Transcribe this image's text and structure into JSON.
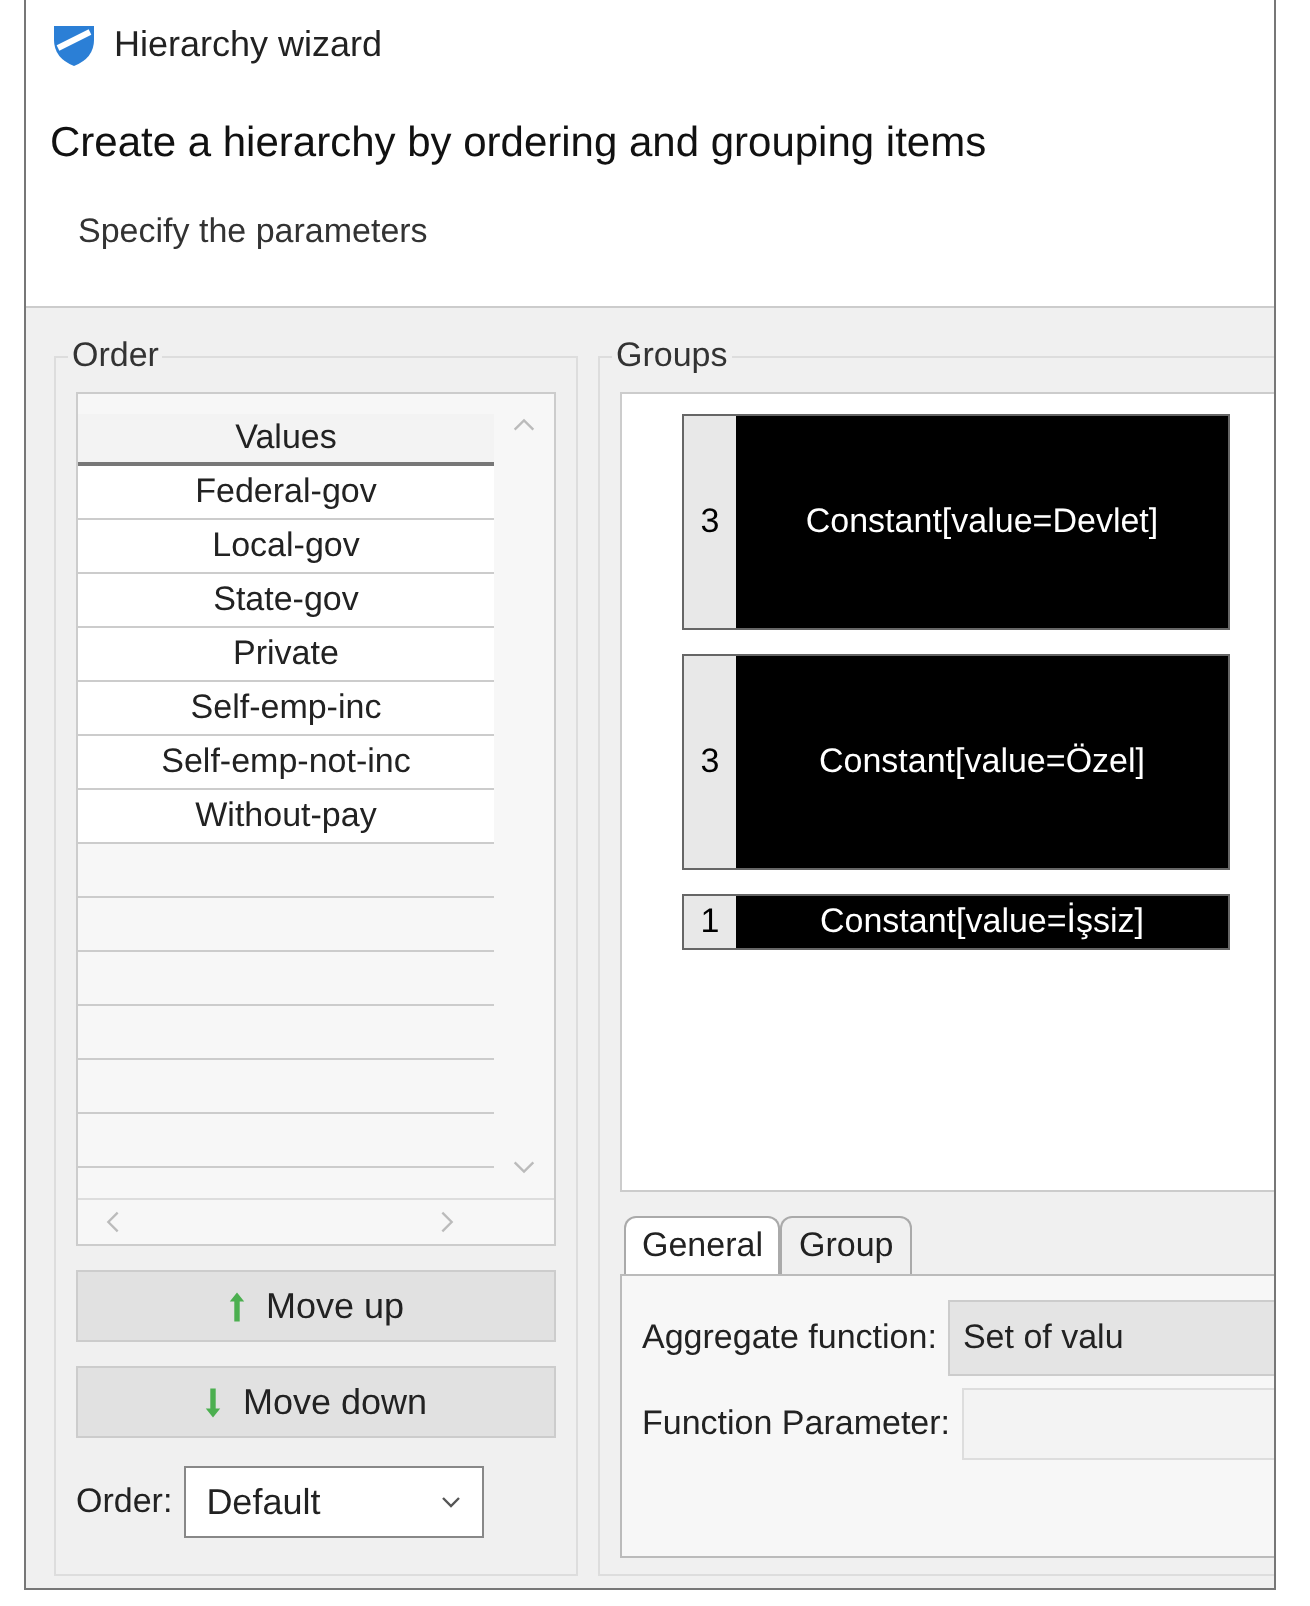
{
  "window": {
    "title": "Hierarchy wizard"
  },
  "header": {
    "title": "Create a hierarchy by ordering and grouping items",
    "subtitle": "Specify the parameters"
  },
  "order_panel": {
    "title": "Order",
    "column": "Values",
    "values": [
      "Federal-gov",
      "Local-gov",
      "State-gov",
      "Private",
      "Self-emp-inc",
      "Self-emp-not-inc",
      "Without-pay"
    ],
    "buttons": [
      {
        "label": "Move up",
        "kind": "up"
      },
      {
        "label": "Move down",
        "kind": "down"
      }
    ],
    "order_label": "Order:",
    "order_value": "Default"
  },
  "groups_panel": {
    "title": "Groups",
    "groups": [
      {
        "count": "3",
        "label": "Constant[value=Devlet]"
      },
      {
        "count": "3",
        "label": "Constant[value=Özel]"
      },
      {
        "count": "1",
        "label": "Constant[value=İşsiz]"
      }
    ]
  },
  "tabs": [
    {
      "label": "General",
      "selected": true
    },
    {
      "label": "Group",
      "selected": false
    }
  ],
  "fields": [
    {
      "label": "Aggregate function:",
      "kind": "select",
      "value": "Set of valu"
    },
    {
      "label": "Function Parameter:",
      "kind": "input"
    }
  ]
}
